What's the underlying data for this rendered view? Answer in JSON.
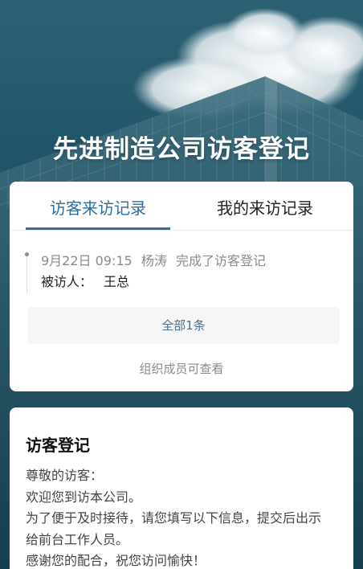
{
  "header": {
    "title": "先进制造公司访客登记"
  },
  "tabs": [
    {
      "label": "访客来访记录",
      "active": true
    },
    {
      "label": "我的来访记录",
      "active": false
    }
  ],
  "records": [
    {
      "time": "9月22日 09:15",
      "name": "杨涛",
      "action": "完成了访客登记",
      "host_label": "被访人：",
      "host_name": "王总"
    }
  ],
  "all_button_label": "全部1条",
  "note": "组织成员可查看",
  "register": {
    "title": "访客登记",
    "lines": [
      "尊敬的访客：",
      "欢迎您到访本公司。",
      "为了便于及时接待，请您填写以下信息，提交后出示",
      "给前台工作人员。",
      "感谢您的配合，祝您访问愉快！"
    ]
  },
  "colors": {
    "accent": "#2b6ea3",
    "hero_bg": "#164659",
    "card_bg": "#ffffff"
  }
}
